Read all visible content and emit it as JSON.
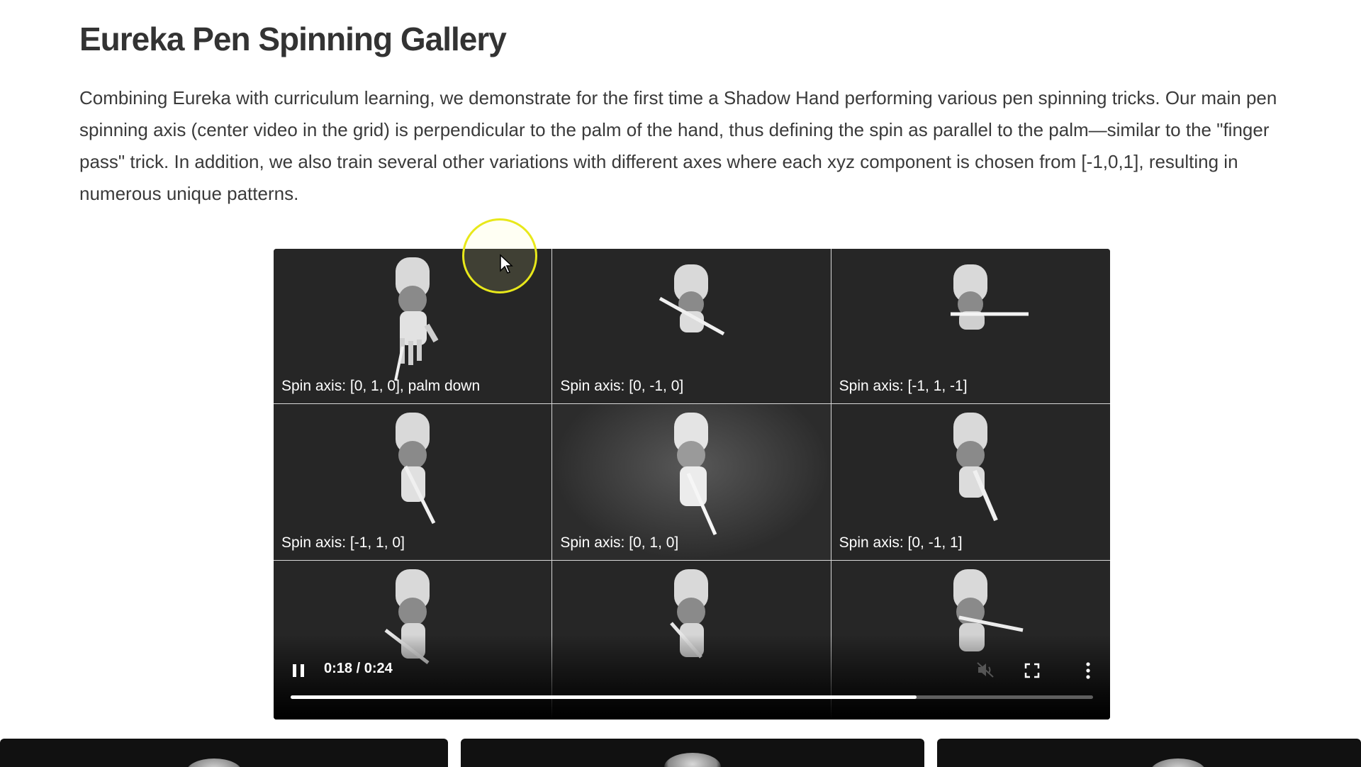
{
  "page": {
    "title": "Eureka Pen Spinning Gallery",
    "description": "Combining Eureka with curriculum learning, we demonstrate for the first time a Shadow Hand performing various pen spinning tricks. Our main pen spinning axis (center video in the grid) is perpendicular to the palm of the hand, thus defining the spin as parallel to the palm—similar to the \"finger pass\" trick. In addition, we also train several other variations with different axes where each xyz component is chosen from [-1,0,1], resulting in numerous unique patterns."
  },
  "video": {
    "cells": [
      {
        "caption": "Spin axis: [0, 1, 0], palm down"
      },
      {
        "caption": "Spin axis: [0, -1, 0]"
      },
      {
        "caption": "Spin axis: [-1, 1, -1]"
      },
      {
        "caption": "Spin axis: [-1, 1, 0]"
      },
      {
        "caption": "Spin axis: [0, 1, 0]"
      },
      {
        "caption": "Spin axis: [0, -1, 1]"
      },
      {
        "caption": ""
      },
      {
        "caption": ""
      },
      {
        "caption": ""
      }
    ],
    "controls": {
      "time": "0:18 / 0:24",
      "progress": 0.78,
      "pause_icon": "pause-icon",
      "mute_icon": "muted-speaker-icon",
      "fullscreen_icon": "fullscreen-icon",
      "more_icon": "more-vertical-icon"
    }
  },
  "colors": {
    "cursor_ring": "#e8e81a",
    "video_background": "#1f1f1f",
    "text": "#333333"
  }
}
